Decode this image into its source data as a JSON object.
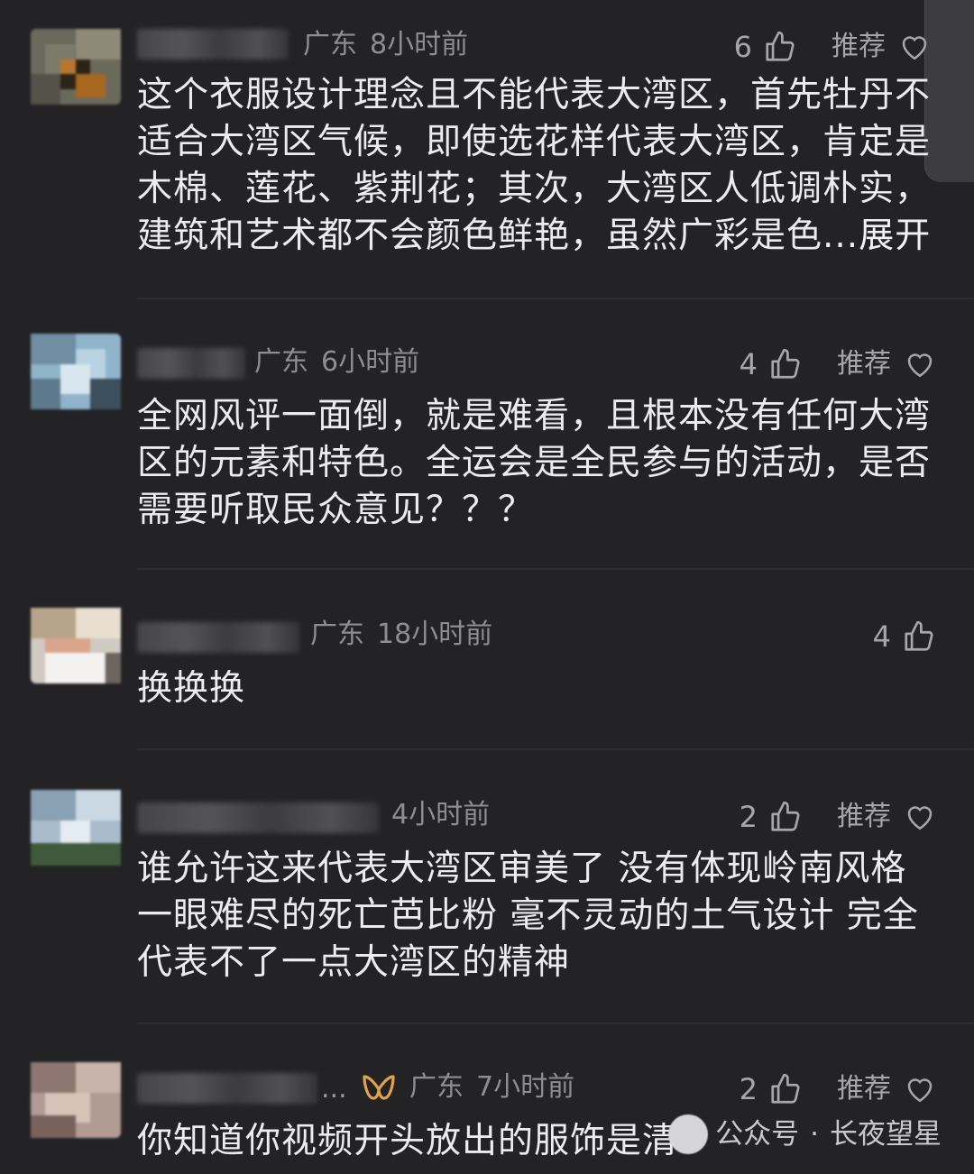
{
  "comments": [
    {
      "location": "广东",
      "time": "8小时前",
      "likes": "6",
      "recommend": "推荐",
      "text": "这个衣服设计理念且不能代表大湾区，首先牡丹不适合大湾区气候，即使选花样代表大湾区，肯定是木棉、莲花、紫荆花；其次，大湾区人低调朴实，建筑和艺术都不会颜色鲜艳，虽然广彩是色...",
      "expand": "展开"
    },
    {
      "location": "广东",
      "time": "6小时前",
      "likes": "4",
      "recommend": "推荐",
      "text": "全网风评一面倒，就是难看，且根本没有任何大湾区的元素和特色。全运会是全民参与的活动，是否需要听取民众意见？？？"
    },
    {
      "location": "广东",
      "time": "18小时前",
      "likes": "4",
      "text": "换换换"
    },
    {
      "time": "4小时前",
      "likes": "2",
      "recommend": "推荐",
      "text": "谁允许这来代表大湾区审美了 没有体现岭南风格 一眼难尽的死亡芭比粉 毫不灵动的土气设计 完全代表不了一点大湾区的精神"
    },
    {
      "name_suffix": "...",
      "location": "广东",
      "time": "7小时前",
      "likes": "2",
      "recommend": "推荐",
      "text": "你知道你视频开头放出的服饰是清"
    }
  ],
  "watermark": {
    "source": "公众号",
    "separator": "·",
    "account": "长夜望星"
  },
  "colors": {
    "background": "#232325",
    "text": "#ececee",
    "meta": "#8d8d92",
    "badge": "#e0a24a"
  },
  "icons": [
    "thumb-up-icon",
    "heart-outline-icon",
    "vip-badge-icon"
  ]
}
